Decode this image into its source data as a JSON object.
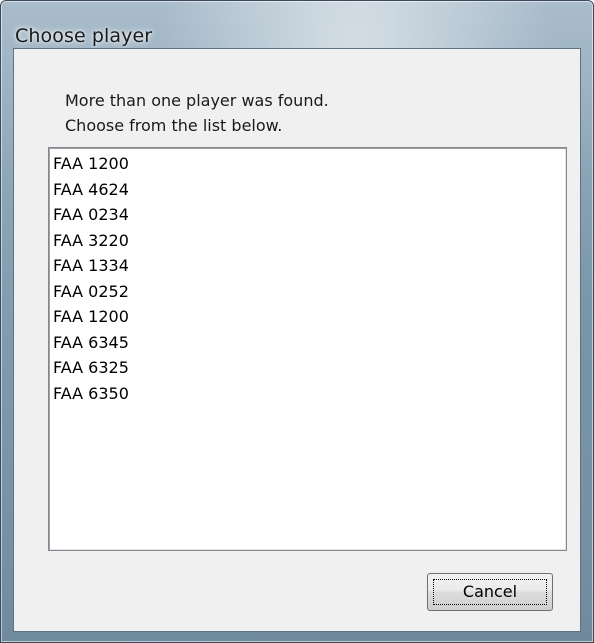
{
  "window": {
    "title": "Choose player"
  },
  "message": {
    "line1": "More than one player was found.",
    "line2": "Choose from the list below."
  },
  "player_list": {
    "items": [
      "FAA 1200",
      "FAA 4624",
      "FAA 0234",
      "FAA 3220",
      "FAA 1334",
      "FAA 0252",
      "FAA 1200",
      "FAA 6345",
      "FAA 6325",
      "FAA 6350"
    ]
  },
  "buttons": {
    "cancel_label": "Cancel"
  }
}
